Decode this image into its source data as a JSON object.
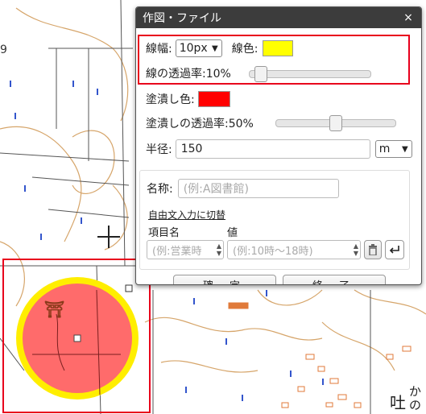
{
  "map": {
    "edge_label": "9",
    "shrine_symbol": "⛩",
    "place_label_kanji": "吐",
    "place_label_kana": "かの"
  },
  "dialog": {
    "title": "作図・ファイル",
    "close_glyph": "×",
    "line_width_label": "線幅:",
    "line_width_value": "10px",
    "line_color_label": "線色:",
    "line_color": "#ffff00",
    "line_transparency_text": "線の透過率:10%",
    "line_transparency_percent": 10,
    "fill_color_label": "塗潰し色:",
    "fill_color": "#ff0000",
    "fill_transparency_text": "塗潰しの透過率:50%",
    "fill_transparency_percent": 50,
    "radius_label": "半径:",
    "radius_value": "150",
    "radius_unit": "m",
    "name_label": "名称:",
    "name_placeholder": "(例:A図書館)",
    "free_text_link": "自由文入力に切替",
    "item_name_header": "項目名",
    "value_header": "値",
    "item_placeholder": "(例:営業時",
    "value_placeholder": "(例:10時〜18時)",
    "confirm_button": "確 定",
    "finish_button": "終 了"
  },
  "colors": {
    "highlight_red": "#e8001c",
    "circle_fill": "#ff6b6b",
    "circle_border": "#ffee00",
    "titlebar": "#3c3c3c"
  }
}
